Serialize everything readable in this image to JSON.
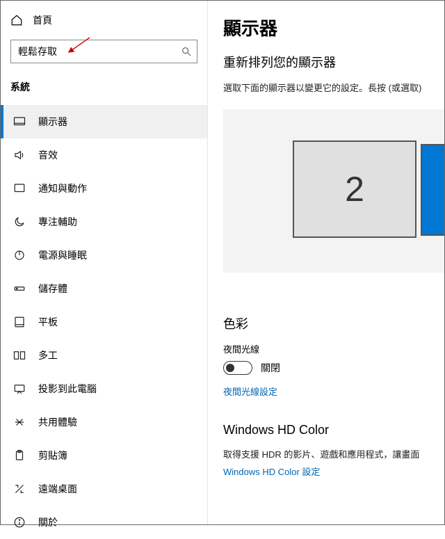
{
  "sidebar": {
    "home_label": "首頁",
    "search_value": "輕鬆存取",
    "section_label": "系統",
    "items": [
      {
        "label": "顯示器"
      },
      {
        "label": "音效"
      },
      {
        "label": "通知與動作"
      },
      {
        "label": "專注輔助"
      },
      {
        "label": "電源與睡眠"
      },
      {
        "label": "儲存體"
      },
      {
        "label": "平板"
      },
      {
        "label": "多工"
      },
      {
        "label": "投影到此電腦"
      },
      {
        "label": "共用體驗"
      },
      {
        "label": "剪貼簿"
      },
      {
        "label": "遠端桌面"
      },
      {
        "label": "關於"
      }
    ]
  },
  "main": {
    "title": "顯示器",
    "rearrange_heading": "重新排列您的顯示器",
    "rearrange_text": "選取下面的顯示器以變更它的設定。長按 (或選取)",
    "monitor_2_label": "2",
    "color_heading": "色彩",
    "night_light_label": "夜間光線",
    "night_light_status": "關閉",
    "night_light_link": "夜間光線設定",
    "hdcolor_heading": "Windows HD Color",
    "hdcolor_text": "取得支援 HDR 的影片、遊戲和應用程式，讓畫面",
    "hdcolor_link": "Windows HD Color 設定"
  }
}
